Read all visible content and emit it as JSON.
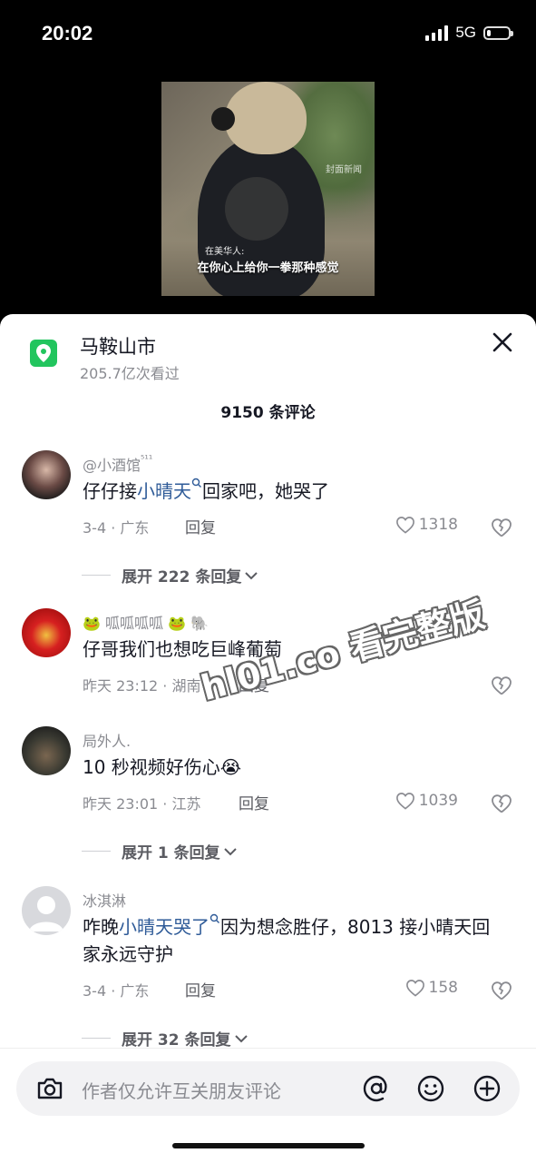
{
  "status_bar": {
    "time": "20:02",
    "network": "5G",
    "battery_level": 0.2
  },
  "video": {
    "speaker_label": "在美华人:",
    "subtitle": "在你心上给你一拳那种感觉",
    "watermark": "封面新闻"
  },
  "header": {
    "location_title": "马鞍山市",
    "views": "205.7亿次看过",
    "comment_count": "9150 条评论",
    "icons": {
      "location": "location-pin-icon",
      "close": "close-icon"
    }
  },
  "comments": [
    {
      "username": "@小酒馆",
      "username_suffix": "⁵¹¹",
      "text_prefix": "仔仔接",
      "text_link": "小晴天",
      "text_suffix": "回家吧，她哭了",
      "meta": "3-4 · 广东",
      "reply_label": "回复",
      "likes": "1318",
      "expand": "展开 222 条回复"
    },
    {
      "username": "🐸 呱呱呱呱 🐸  🐘",
      "text": "仔哥我们也想吃巨峰葡萄",
      "meta": "昨天 23:12 · 湖南",
      "reply_label": "回复"
    },
    {
      "username": "局外人.",
      "text": "10 秒视频好伤心😭",
      "meta": "昨天 23:01 · 江苏",
      "reply_label": "回复",
      "likes": "1039",
      "expand": "展开 1 条回复"
    },
    {
      "username": "冰淇淋",
      "text_prefix": "咋晚",
      "text_link": "小晴天哭了",
      "text_suffix": "因为想念胜仔，8013 接小晴天回家永远守护",
      "meta": "3-4 · 广东",
      "reply_label": "回复",
      "likes": "158",
      "expand": "展开 32 条回复"
    }
  ],
  "overlay_text": "hl01.co 看完整版",
  "input": {
    "placeholder": "作者仅允许互关朋友评论",
    "icons": [
      "camera-icon",
      "at-icon",
      "emoji-icon",
      "add-icon"
    ]
  },
  "colors": {
    "accent_link": "#2f5b98",
    "location_green": "#22c55e"
  }
}
